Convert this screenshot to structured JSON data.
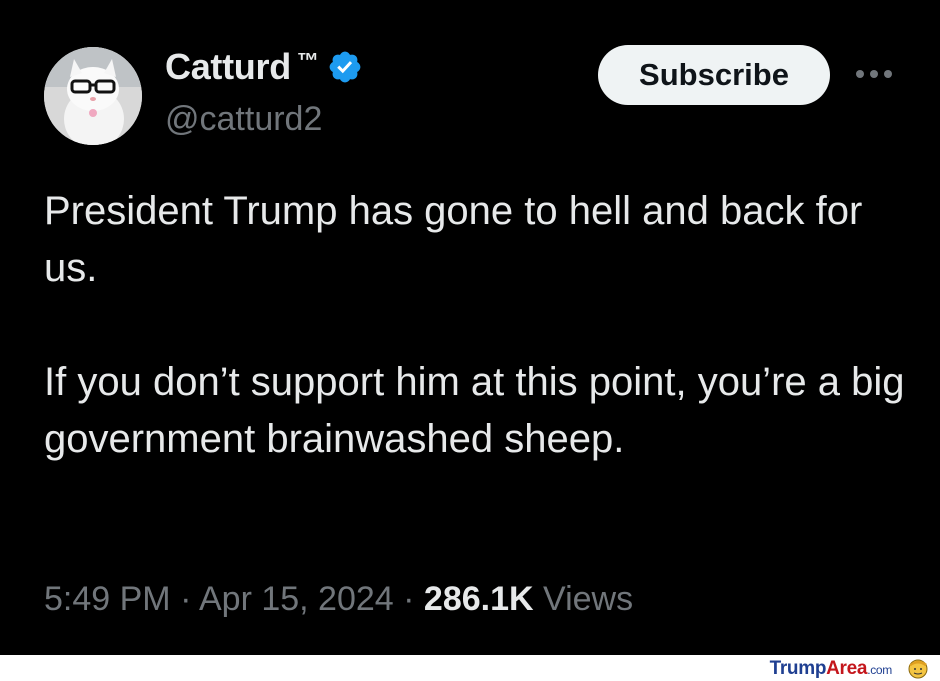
{
  "tweet": {
    "author": {
      "display_name": "Catturd",
      "trademark": "™",
      "handle": "@catturd2",
      "verified": true
    },
    "subscribe_label": "Subscribe",
    "paragraphs": [
      "President Trump has gone to hell and back for us.",
      "If you don’t support him at this point, you’re a big government brainwashed sheep."
    ],
    "time": "5:49 PM",
    "separator": "·",
    "date": "Apr 15, 2024",
    "views_count": "286.1K",
    "views_label": "Views"
  },
  "watermark": {
    "part1": "Trump",
    "part2": "Area",
    "part3": ".com"
  },
  "colors": {
    "background": "#000000",
    "primary_text": "#e7e9ea",
    "secondary_text": "#71767b",
    "verified_badge": "#1d9bf0",
    "button_bg": "#eff3f4"
  },
  "icons": {
    "verified": "verified-badge-icon",
    "more": "more-options-icon",
    "watermark": "trump-face-icon"
  }
}
